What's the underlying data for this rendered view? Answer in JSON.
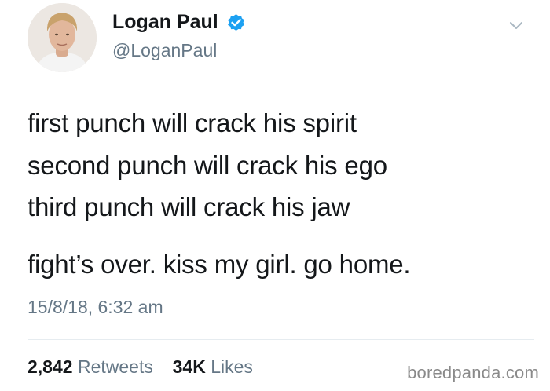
{
  "tweet": {
    "author": {
      "display_name": "Logan Paul",
      "handle": "@LoganPaul",
      "verified": true,
      "verified_icon": "verified-badge-icon",
      "avatar_icon": "profile-avatar"
    },
    "menu_icon": "chevron-down-icon",
    "text_lines": [
      "first punch will crack his spirit",
      "second punch will crack his ego",
      "third punch will crack his jaw",
      "fight’s over. kiss my girl. go home."
    ],
    "timestamp": "15/8/18, 6:32 am",
    "stats": {
      "retweets_count": "2,842",
      "retweets_label": "Retweets",
      "likes_count": "34K",
      "likes_label": "Likes"
    }
  },
  "watermark": "boredpanda.com",
  "colors": {
    "text_primary": "#14171a",
    "text_secondary": "#657786",
    "verified_blue": "#1da1f2",
    "divider": "#e6ecf0"
  }
}
